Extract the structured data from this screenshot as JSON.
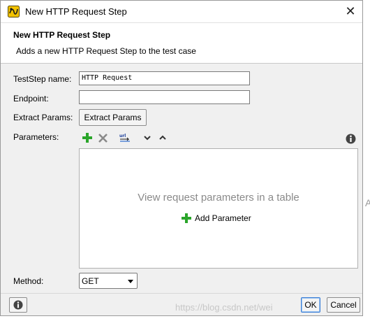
{
  "window": {
    "title": "New HTTP Request Step",
    "close_glyph": "✕"
  },
  "header": {
    "title": "New HTTP Request Step",
    "description": "Adds a new HTTP Request Step to the test case"
  },
  "form": {
    "teststep_name_label": "TestStep name:",
    "teststep_name_value": "HTTP Request",
    "endpoint_label": "Endpoint:",
    "endpoint_value": "",
    "extract_params_label": "Extract Params:",
    "extract_params_button": "Extract Params",
    "parameters_label": "Parameters:",
    "method_label": "Method:",
    "method_value": "GET"
  },
  "toolbar": {
    "icons": [
      "add-icon",
      "remove-icon",
      "url-encode-icon",
      "move-down-icon",
      "move-up-icon",
      "info-icon"
    ]
  },
  "params_panel": {
    "empty_message": "View request parameters in a table",
    "add_parameter_label": "Add Parameter"
  },
  "footer": {
    "ok_label": "OK",
    "cancel_label": "Cancel",
    "watermark": "https://blog.csdn.net/wei"
  },
  "colors": {
    "add_green": "#2aa52a",
    "info_dark": "#444444"
  },
  "edge_text": "A"
}
